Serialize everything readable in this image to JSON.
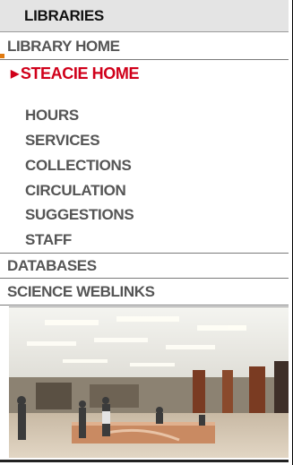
{
  "header": {
    "title": "LIBRARIES"
  },
  "nav": {
    "library_home": "LIBRARY HOME",
    "current": "STEACIE HOME",
    "current_arrow": "▶",
    "sub_items": [
      "HOURS",
      "SERVICES",
      "COLLECTIONS",
      "CIRCULATION",
      "SUGGESTIONS",
      "STAFF"
    ],
    "databases": "DATABASES",
    "science_weblinks": "SCIENCE WEBLINKS"
  },
  "colors": {
    "current_link": "#d0001a",
    "link": "#555555",
    "header_bg": "#e4e4e4"
  },
  "photo": {
    "icon": "library-interior-photo"
  }
}
